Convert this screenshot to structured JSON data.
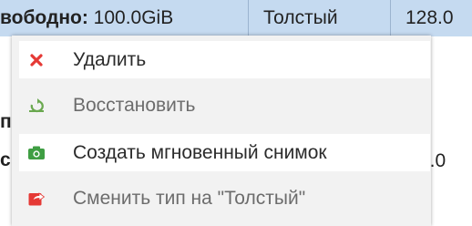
{
  "table_row": {
    "col1_label": "вободно:",
    "col1_value": " 100.0GiB",
    "col2": "Толстый",
    "col3": "128.0"
  },
  "background": {
    "fragment_1": "п",
    "fragment_2": "с",
    "fragment_3": "4.0"
  },
  "context_menu": {
    "items": [
      {
        "label": "Удалить",
        "icon": "close-icon",
        "icon_color": "#e53935",
        "enabled": true
      },
      {
        "label": "Восстановить",
        "icon": "restore-icon",
        "icon_color": "#6aa84f",
        "enabled": false
      },
      {
        "label": "Создать мгновенный снимок",
        "icon": "camera-icon",
        "icon_color": "#3f9e43",
        "enabled": true
      },
      {
        "label": "Сменить тип на \"Толстый\"",
        "icon": "share-icon",
        "icon_color": "#e53935",
        "enabled": false
      }
    ]
  }
}
